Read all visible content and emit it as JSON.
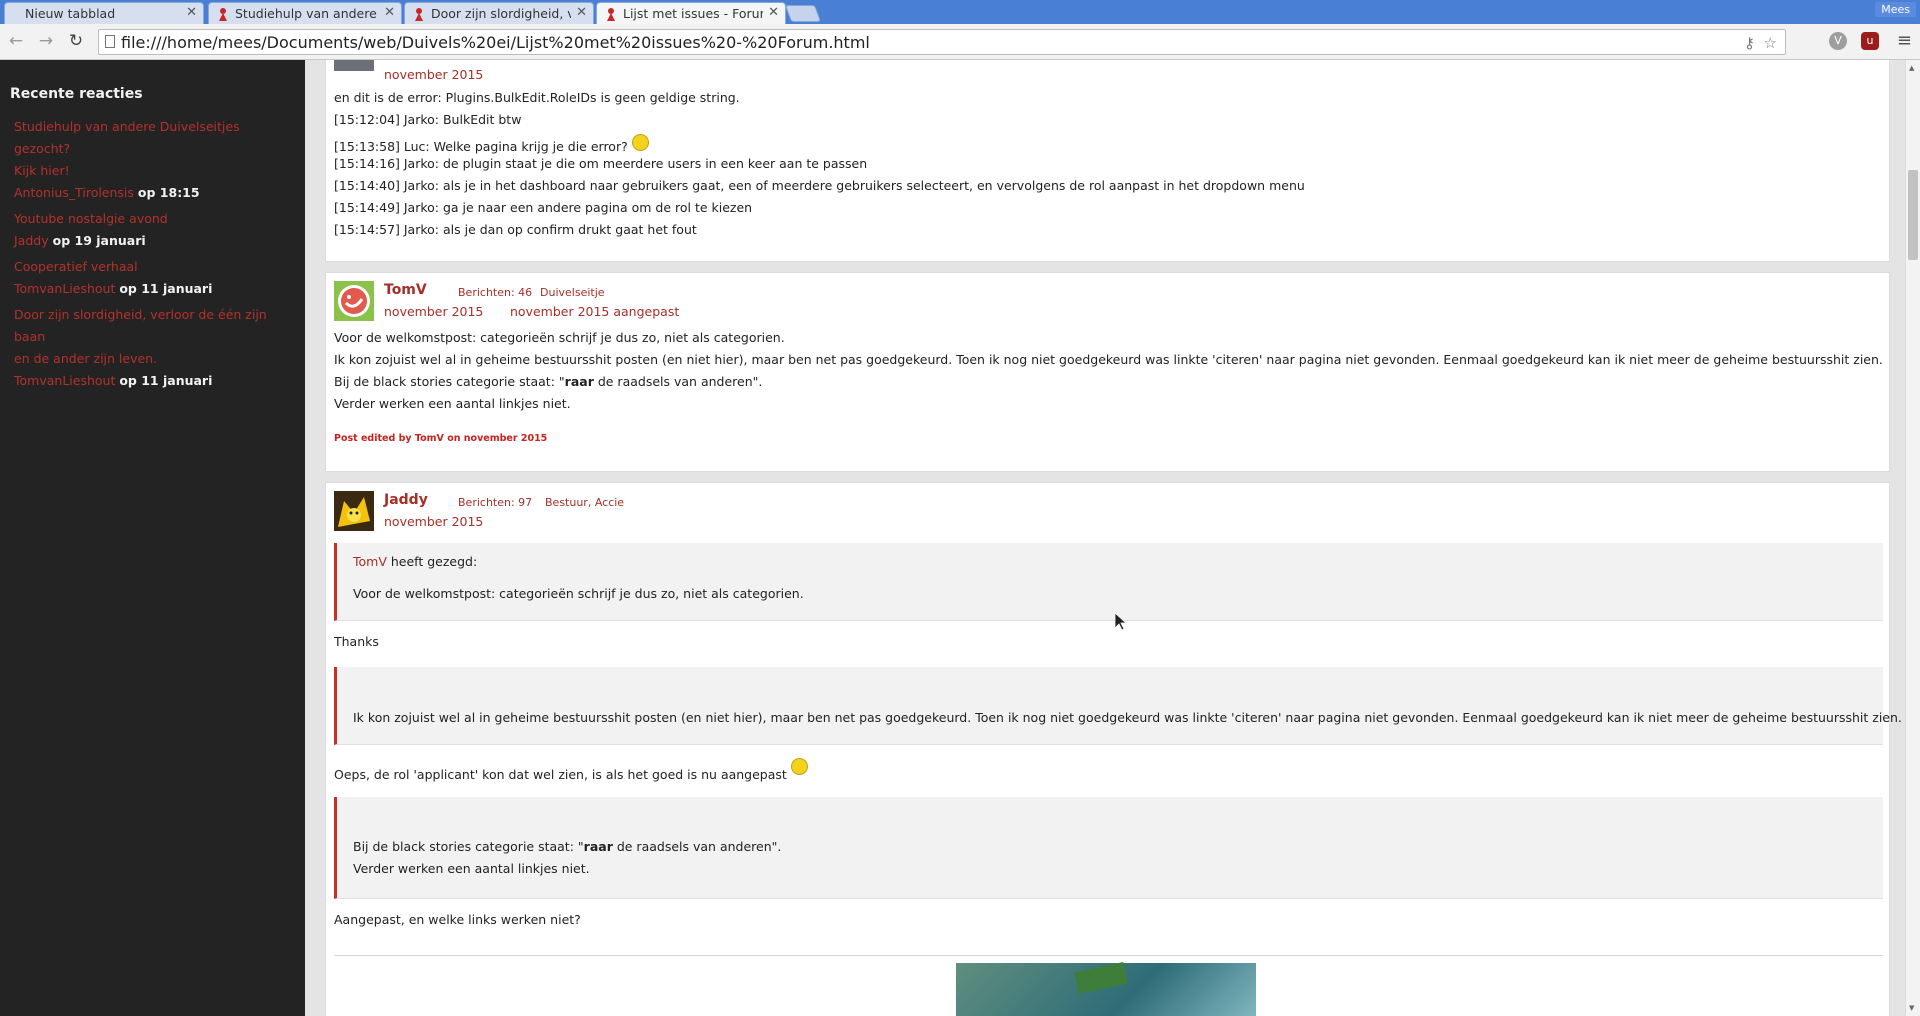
{
  "browser": {
    "tabs": [
      {
        "label": "Nieuw tabblad",
        "favicon": false,
        "active": false
      },
      {
        "label": "Studiehulp van andere",
        "favicon": true,
        "active": false
      },
      {
        "label": "Door zijn slordigheid, v",
        "favicon": true,
        "active": false
      },
      {
        "label": "Lijst met issues - Forum",
        "favicon": true,
        "active": true
      }
    ],
    "user": "Mees",
    "url": "file:///home/mees/Documents/web/Duivels%20ei/Lijst%20met%20issues%20-%20Forum.html",
    "icons": {
      "back": "back-arrow-icon",
      "forward": "forward-arrow-icon",
      "reload": "reload-icon",
      "bookmark": "star-icon",
      "menu": "hamburger-menu-icon"
    }
  },
  "sidebar": {
    "title": "Recente reacties",
    "items": [
      {
        "topic": "Studiehulp van andere Duivelseitjes gezocht?",
        "topic2": "Kijk hier!",
        "user": "Antonius_Tirolensis",
        "when": "op 18:15"
      },
      {
        "topic": "Youtube nostalgie avond",
        "topic2": "",
        "user": "Jaddy",
        "when": "op 19 januari"
      },
      {
        "topic": "Cooperatief verhaal",
        "topic2": "",
        "user": "TomvanLieshout",
        "when": "op 11 januari"
      },
      {
        "topic": "Door zijn slordigheid, verloor de één zijn baan",
        "topic2": "en de ander zijn leven.",
        "user": "TomvanLieshout",
        "when": "op 11 januari"
      }
    ]
  },
  "posts": {
    "first": {
      "date": "november 2015",
      "lines": [
        "en dit is de error: Plugins.BulkEdit.RoleIDs is geen geldige string.",
        "[15:12:04] Jarko: BulkEdit btw",
        "[15:13:58] Luc: Welke pagina krijg je die error?",
        "[15:14:16] Jarko: de plugin staat je die om meerdere users in een keer aan te passen",
        "[15:14:40] Jarko: als je in het dashboard naar gebruikers gaat, een of meerdere gebruikers selecteert, en vervolgens de rol aanpast in het dropdown menu",
        "[15:14:49] Jarko: ga je naar een andere pagina om de rol te kiezen",
        "[15:14:57] Jarko: als je dan op confirm drukt gaat het fout"
      ]
    },
    "tomv": {
      "author": "TomV",
      "count": "Berichten: 46",
      "role": "Duivelseitje",
      "date": "november 2015",
      "edited": "november 2015 aangepast",
      "lines": [
        "Voor de welkomstpost: categorieën schrijf je dus zo, niet als categorien.",
        "Ik kon zojuist wel al in geheime bestuursshit posten (en niet hier), maar ben net pas goedgekeurd. Toen ik nog niet goedgekeurd was linkte 'citeren' naar pagina niet gevonden. Eenmaal goedgekeurd kan ik niet meer de geheime bestuursshit zien.",
        "Bij de black stories categorie staat: \"",
        "raar",
        " de raadsels van anderen\".",
        "Verder werken een aantal linkjes niet."
      ],
      "edit_note": "Post edited by TomV on november 2015"
    },
    "jaddy": {
      "author": "Jaddy",
      "count": "Berichten: 97",
      "role": "Bestuur, Accie",
      "date": "november 2015",
      "quote1_author": "TomV",
      "quote1_said": " heeft gezegd:",
      "quote1_text": "Voor de welkomstpost: categorieën schrijf je dus zo, niet als categorien.",
      "thanks": "Thanks",
      "quote2_text": "Ik kon zojuist wel al in geheime bestuursshit posten (en niet hier), maar ben net pas goedgekeurd. Toen ik nog niet goedgekeurd was linkte 'citeren' naar pagina niet gevonden. Eenmaal goedgekeurd kan ik niet meer de geheime bestuursshit zien.",
      "reply2": "Oeps, de rol 'applicant' kon dat wel zien, is als het goed is nu aangepast",
      "quote3_pre": "Bij de black stories categorie staat: \"",
      "quote3_bold": "raar",
      "quote3_post": " de raadsels van anderen\".",
      "quote3_line2": "Verder werken een aantal linkjes niet.",
      "reply3": "Aangepast, en welke links werken niet?"
    }
  },
  "colors": {
    "accent": "#a72f27",
    "sidebar_bg": "#232323",
    "quote_border": "#c9302c"
  }
}
